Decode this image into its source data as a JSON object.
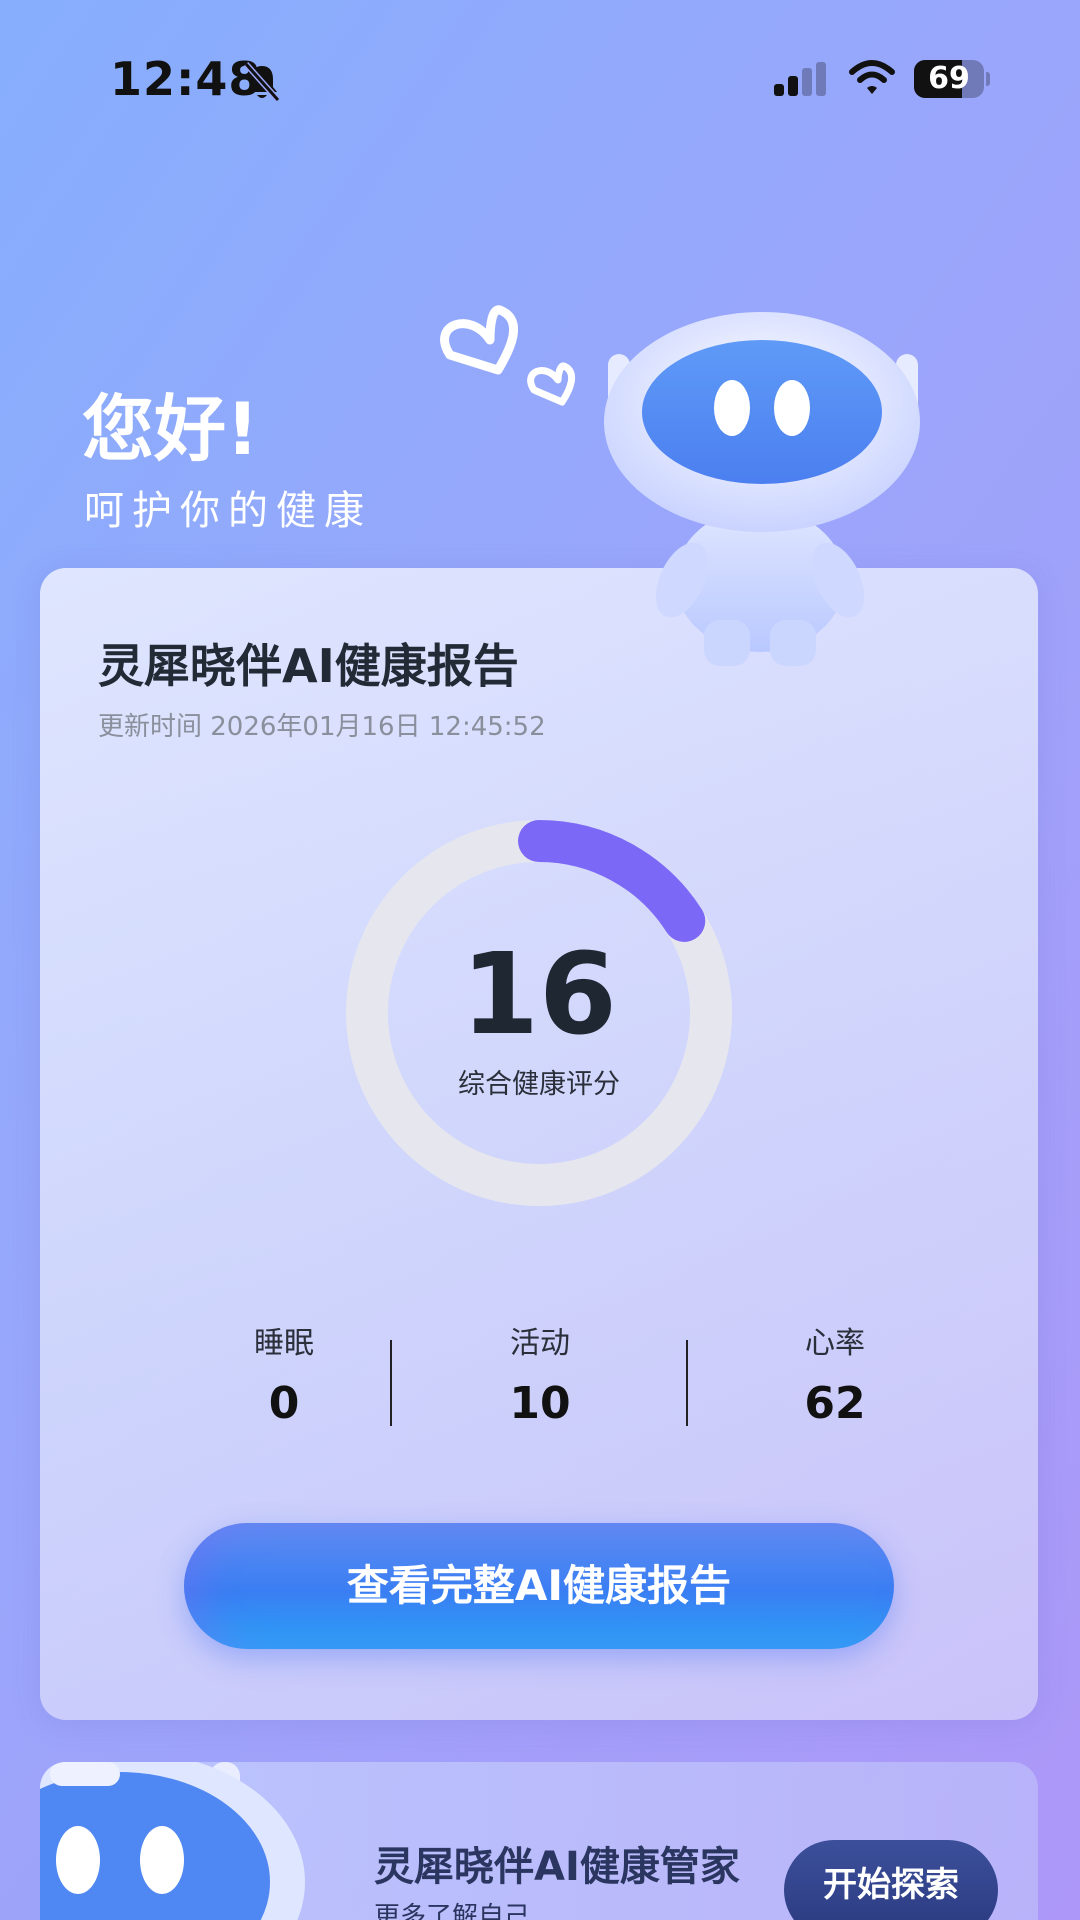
{
  "status_bar": {
    "time": "12:48",
    "battery_level": "69",
    "battery_fraction": 0.69
  },
  "greeting": {
    "title": "您好!",
    "subtitle": "呵护你的健康"
  },
  "report_card": {
    "title": "灵犀晓伴AI健康报告",
    "updated": "更新时间 2026年01月16日 12:45:52",
    "score": {
      "value": "16",
      "label": "综合健康评分",
      "max": 100
    },
    "metrics": [
      {
        "label": "睡眠",
        "value": "0"
      },
      {
        "label": "活动",
        "value": "10"
      },
      {
        "label": "心率",
        "value": "62"
      }
    ],
    "button_label": "查看完整AI健康报告"
  },
  "manager_card": {
    "title": "灵犀晓伴AI健康管家",
    "subtitle": "更多了解自己",
    "button_label": "开始探索"
  },
  "colors": {
    "ring_progress": "#7b68f7",
    "ring_track": "#e6e7ee",
    "button_blue": "#3a7ef3"
  },
  "icons": [
    "bell-slash-icon",
    "cellular-signal-icon",
    "wifi-icon",
    "battery-icon",
    "robot-mascot",
    "heart-icon"
  ]
}
